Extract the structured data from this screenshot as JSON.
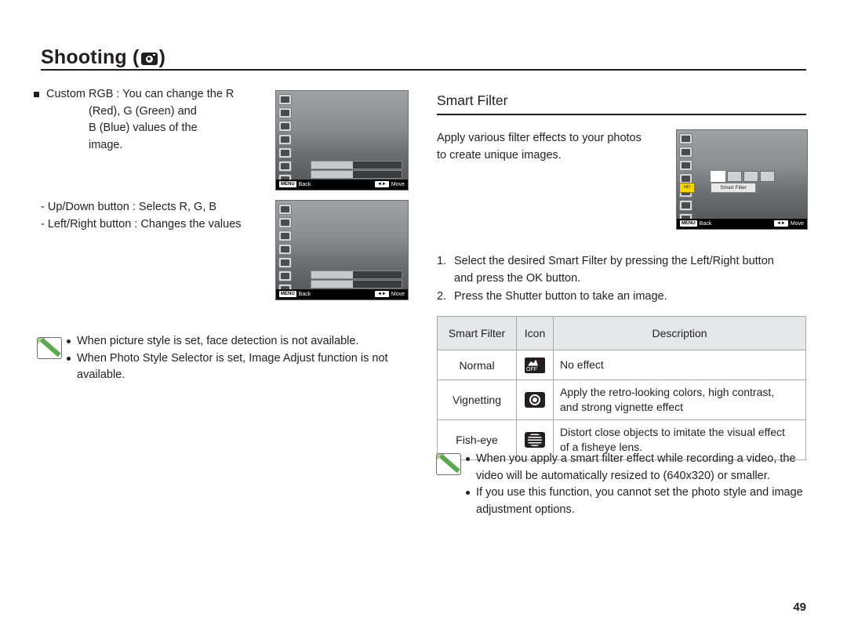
{
  "header": {
    "title": "Shooting (",
    "title_end": ")",
    "camera_icon": "camera-icon"
  },
  "left": {
    "bullet_title": "Custom RGB : You can change the R",
    "bullet_line2": "(Red), G (Green) and",
    "bullet_line3": "B (Blue) values of the",
    "bullet_line4": "image.",
    "updown": "- Up/Down button : Selects R, G, B",
    "leftright": "- Left/Right button : Changes the values"
  },
  "note_left": {
    "icon": "note-pencil-icon",
    "line1": "When picture style is set, face detection is not available.",
    "line2": "When Photo Style Selector is set, Image Adjust function is not",
    "line2_cont": "available."
  },
  "right": {
    "section_title": "Smart Filter",
    "intro_line1": "Apply various filter effects to your photos",
    "intro_line2": "to create unique images.",
    "steps": [
      {
        "num": "1.",
        "line1": "Select the desired Smart Filter by pressing the Left/Right button",
        "line2": "and press the OK button."
      },
      {
        "num": "2.",
        "line1": "Press the Shutter button to take an image.",
        "line2": ""
      }
    ]
  },
  "table": {
    "headers": [
      "Smart Filter",
      "Icon",
      "Description"
    ],
    "rows": [
      {
        "name": "Normal",
        "icon": "smart-filter-normal-icon",
        "desc_line1": "No effect",
        "desc_line2": ""
      },
      {
        "name": "Vignetting",
        "icon": "smart-filter-vignetting-icon",
        "desc_line1": "Apply the retro-looking colors, high contrast,",
        "desc_line2": "and strong vignette effect"
      },
      {
        "name": "Fish-eye",
        "icon": "smart-filter-fisheye-icon",
        "desc_line1": "Distort close objects to imitate the visual effect",
        "desc_line2": "of a fisheye lens."
      }
    ]
  },
  "note_right": {
    "icon": "note-pencil-icon",
    "line1": "When you apply a smart filter effect while recording a video, the",
    "line1_cont": "video will be automatically resized to (640x320) or smaller.",
    "line2": "If you use this function, you cannot set the photo style and image",
    "line2_cont": "adjustment options."
  },
  "lcd": {
    "back_label": "Back",
    "move_label": "Move",
    "menu_key": "MENU",
    "move_key": "◄►",
    "smart_filter_label": "Smart Filter",
    "sf_tab_label": "ND"
  },
  "page_number": "49"
}
